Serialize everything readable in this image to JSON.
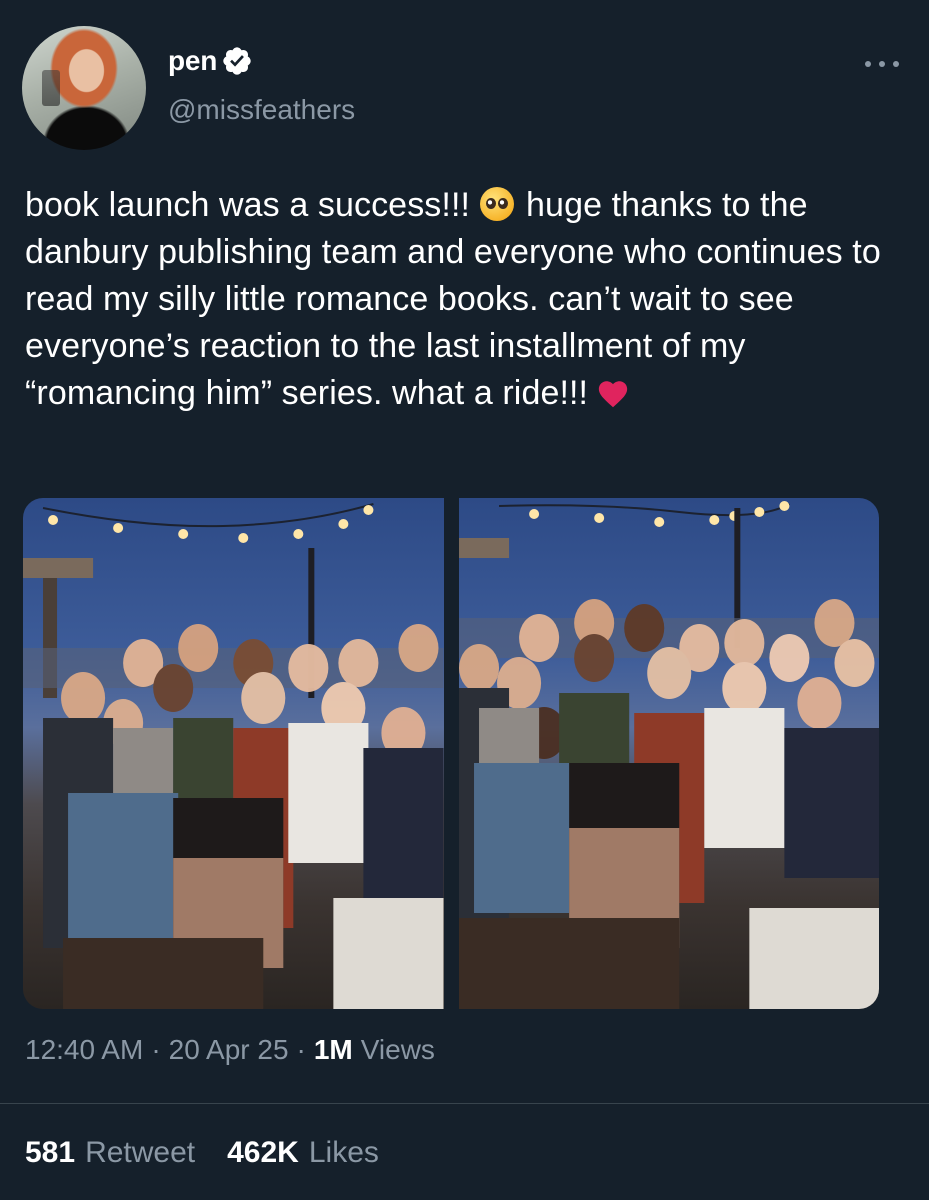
{
  "tweet": {
    "author": {
      "display_name": "pen",
      "handle": "@missfeathers",
      "verified": true
    },
    "text_parts": {
      "part1": "book launch was a success!!!",
      "emoji1": "pleading-face-emoji",
      "part2": "huge thanks to the danbury publishing team and everyone who continues to read my silly little romance books. can’t wait to see everyone’s reaction to the last installment of my “romancing him” series. what a ride!!!",
      "emoji2": "red-heart-emoji"
    },
    "media_count": 2,
    "timestamp": {
      "time": "12:40 AM",
      "date": "20 Apr 25",
      "separator": "·",
      "views_count": "1M",
      "views_label": "Views"
    },
    "stats": {
      "retweets_count": "581",
      "retweets_label": "Retweet",
      "likes_count": "462K",
      "likes_label": "Likes"
    }
  },
  "colors": {
    "background": "#15202b",
    "text_primary": "#ffffff",
    "text_secondary": "#8b98a5",
    "divider": "#38444d"
  },
  "icons": {
    "verified": "verified-badge-icon",
    "more": "more-options-icon"
  }
}
